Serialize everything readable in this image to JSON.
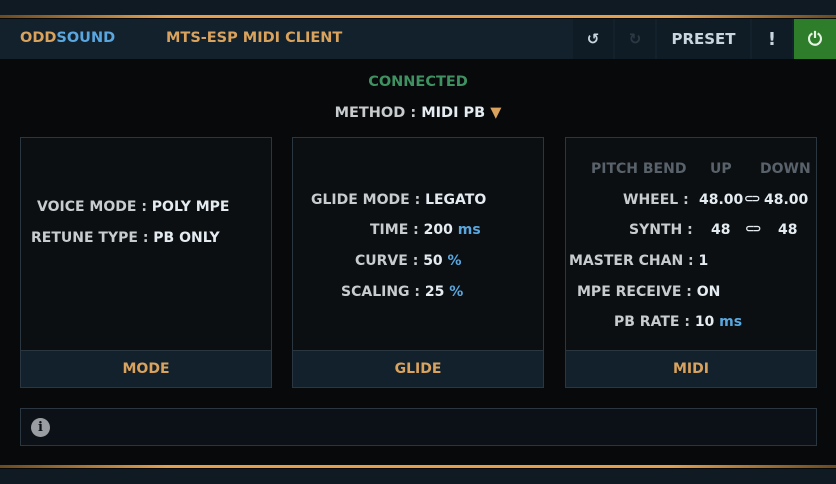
{
  "header": {
    "brand_a": "ODD",
    "brand_b": "SOUND",
    "title": "MTS-ESP MIDI CLIENT",
    "undo": "↺",
    "redo": "↻",
    "preset": "PRESET",
    "alert": "!",
    "power": "⏻"
  },
  "status": "CONNECTED",
  "method": {
    "label": "METHOD",
    "sep": ":",
    "value": "MIDI PB",
    "arrow": "▼"
  },
  "mode": {
    "voice_label": "VOICE MODE",
    "voice_value": "POLY MPE",
    "retune_label": "RETUNE TYPE",
    "retune_value": "PB ONLY",
    "tab": "MODE"
  },
  "glide": {
    "mode_label": "GLIDE MODE",
    "mode_value": "LEGATO",
    "time_label": "TIME",
    "time_value": "200",
    "time_unit": "ms",
    "curve_label": "CURVE",
    "curve_value": "50",
    "curve_unit": "%",
    "scaling_label": "SCALING",
    "scaling_value": "25",
    "scaling_unit": "%",
    "tab": "GLIDE"
  },
  "midi": {
    "pb_header": "PITCH BEND",
    "up": "UP",
    "down": "DOWN",
    "wheel_label": "WHEEL",
    "wheel_up": "48.00",
    "wheel_down": "48.00",
    "synth_label": "SYNTH",
    "synth_up": "48",
    "synth_down": "48",
    "master_label": "MASTER CHAN",
    "master_value": "1",
    "mpe_label": "MPE RECEIVE",
    "mpe_value": "ON",
    "pbrate_label": "PB RATE",
    "pbrate_value": "10",
    "pbrate_unit": "ms",
    "tab": "MIDI",
    "link": "⊂⊃"
  },
  "info": {
    "icon": "i"
  },
  "colors": {
    "accent": "#d9a25d",
    "blue": "#5aa7df",
    "green": "#3f9161",
    "power_bg": "#2e7d2a"
  }
}
